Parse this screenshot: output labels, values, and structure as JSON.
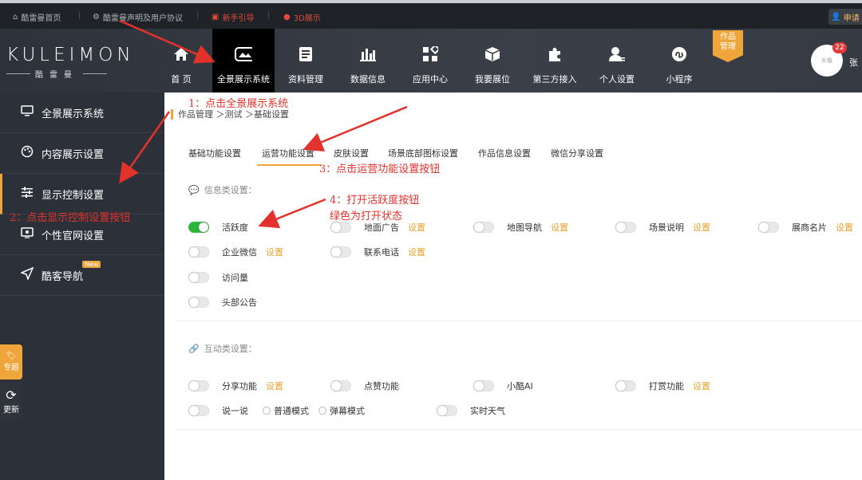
{
  "topbar": {
    "home": "酷雷曼首页",
    "disclaimer": "酷雷曼声明及用户协议",
    "guide": "新手引导",
    "show3d": "3D展示",
    "apply": "申请"
  },
  "logo": {
    "main": "KULEIMON",
    "sub": "酷雷曼"
  },
  "nav": {
    "items": [
      {
        "label": "首 页",
        "icon": "home-icon"
      },
      {
        "label": "全景展示系统",
        "icon": "panorama-icon",
        "active": true
      },
      {
        "label": "资料管理",
        "icon": "document-icon"
      },
      {
        "label": "数据信息",
        "icon": "bar-chart-icon"
      },
      {
        "label": "应用中心",
        "icon": "apps-grid-icon"
      },
      {
        "label": "我要展位",
        "icon": "box-icon"
      },
      {
        "label": "第三方接入",
        "icon": "puzzle-icon"
      },
      {
        "label": "个人设置",
        "icon": "user-settings-icon"
      },
      {
        "label": "小程序",
        "icon": "mini-program-icon"
      }
    ],
    "works_ribbon": "作品\n管理",
    "avatar_text": "头像",
    "badge": "22",
    "username": "张"
  },
  "sidebar": {
    "items": [
      {
        "label": "全景展示系统",
        "icon": "monitor-icon"
      },
      {
        "label": "内容展示设置",
        "icon": "palette-icon"
      },
      {
        "label": "显示控制设置",
        "icon": "sliders-icon",
        "active": true
      },
      {
        "label": "个性官网设置",
        "icon": "website-icon"
      },
      {
        "label": "酷客导航",
        "icon": "navigation-icon",
        "new": "New"
      }
    ],
    "float_tabs": [
      {
        "label": "专题",
        "icon": "tag-icon",
        "color": "#f0a53b"
      },
      {
        "label": "更新",
        "icon": "refresh-icon",
        "color": "#2f333a"
      }
    ]
  },
  "breadcrumb": "作品管理 ＞测试 ＞基础设置",
  "tabs": [
    "基础功能设置",
    "运营功能设置",
    "皮肤设置",
    "场景底部图标设置",
    "作品信息设置",
    "微信分享设置"
  ],
  "info_section": {
    "title": "信息类设置：",
    "items": [
      {
        "label": "活跃度",
        "on": true,
        "setting": ""
      },
      {
        "label": "地面广告",
        "on": false,
        "setting": "设置"
      },
      {
        "label": "地图导航",
        "on": false,
        "setting": "设置"
      },
      {
        "label": "场景说明",
        "on": false,
        "setting": "设置"
      },
      {
        "label": "展商名片",
        "on": false,
        "setting": "设置"
      },
      {
        "label": "企业微信",
        "on": false,
        "setting": "设置"
      },
      {
        "label": "联系电话",
        "on": false,
        "setting": "设置"
      },
      {
        "label": "访问量",
        "on": false,
        "setting": ""
      },
      {
        "label": "头部公告",
        "on": false,
        "setting": ""
      }
    ]
  },
  "interact_section": {
    "title": "互动类设置：",
    "items": [
      {
        "label": "分享功能",
        "on": false,
        "setting": "设置"
      },
      {
        "label": "点赞功能",
        "on": false,
        "setting": ""
      },
      {
        "label": "小酷AI",
        "on": false,
        "setting": ""
      },
      {
        "label": "打赏功能",
        "on": false,
        "setting": "设置"
      },
      {
        "label": "说一说",
        "on": false,
        "setting": ""
      },
      {
        "label": "实时天气",
        "on": false,
        "setting": ""
      }
    ],
    "modes": [
      "普通模式",
      "弹幕模式"
    ]
  },
  "annotations": {
    "a1": "1：点击全景展示系统",
    "a2": "2：点击显示控制设置按钮",
    "a3": "3：点击运营功能设置按钮",
    "a4_line1": "4：打开活跃度按钮",
    "a4_line2": "绿色为打开状态"
  },
  "colors": {
    "accent": "#f0a53b",
    "toggle_on": "#2db53a",
    "annotation": "#e3322b",
    "setting_link": "#e9a22f"
  }
}
